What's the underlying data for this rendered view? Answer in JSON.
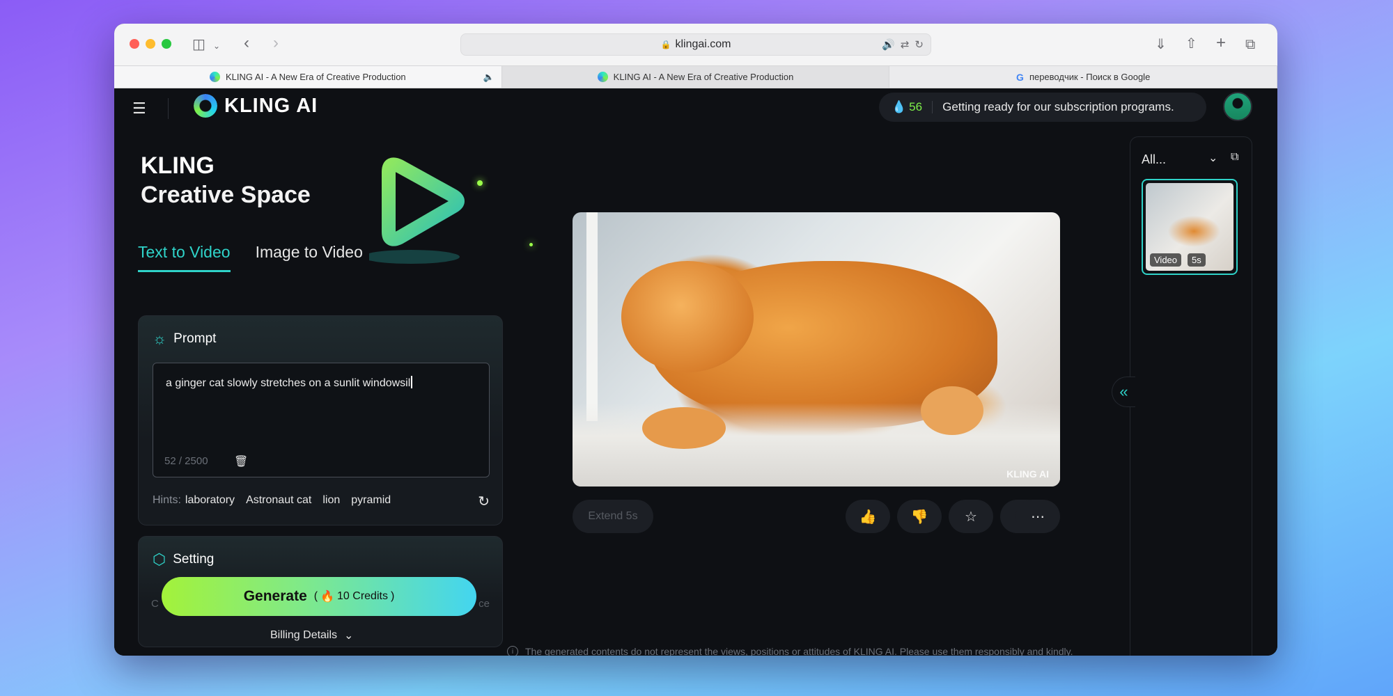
{
  "browser": {
    "url": "klingai.com",
    "tabs": [
      {
        "title": "KLING AI - A New Era of Creative Production",
        "state": "active"
      },
      {
        "title": "KLING AI - A New Era of Creative Production",
        "state": "dim"
      },
      {
        "title": "переводчик - Поиск в Google",
        "state": "normal"
      }
    ]
  },
  "header": {
    "logo_text": "KLING AI",
    "credits": "56",
    "announcement": "Getting ready for our subscription programs."
  },
  "hero": {
    "line1": "KLING",
    "line2": "Creative Space"
  },
  "mode_tabs": {
    "text_to_video": "Text to Video",
    "image_to_video": "Image to Video"
  },
  "prompt": {
    "title": "Prompt",
    "value": "a ginger cat slowly stretches on a sunlit windowsil",
    "count": "52 / 2500",
    "hints_label": "Hints:",
    "hints": [
      "laboratory",
      "Astronaut cat",
      "lion",
      "pyramid"
    ]
  },
  "setting": {
    "title": "Setting",
    "left_fade": "C",
    "right_fade": "ce"
  },
  "generate": {
    "label": "Generate",
    "credits_open": "(",
    "credits_text": "10 Credits",
    "credits_close": ")"
  },
  "billing": "Billing Details",
  "video": {
    "watermark": "KLING AI",
    "extend_label": "Extend 5s"
  },
  "actions": {
    "like_icon": "thumbs-up-icon",
    "dislike_icon": "thumbs-down-icon",
    "favorite_icon": "star-icon",
    "download_icon": "download-icon",
    "more_icon": "more-icon"
  },
  "disclaimer": "The generated contents do not represent the views, positions or attitudes of KLING AI. Please use them responsibly and kindly.",
  "history": {
    "filter_label": "All...",
    "items": [
      {
        "type": "Video",
        "duration": "5s"
      }
    ]
  },
  "colors": {
    "accent": "#2fd3c9",
    "credits_green": "#7ef04a",
    "background": "#0e1014"
  }
}
